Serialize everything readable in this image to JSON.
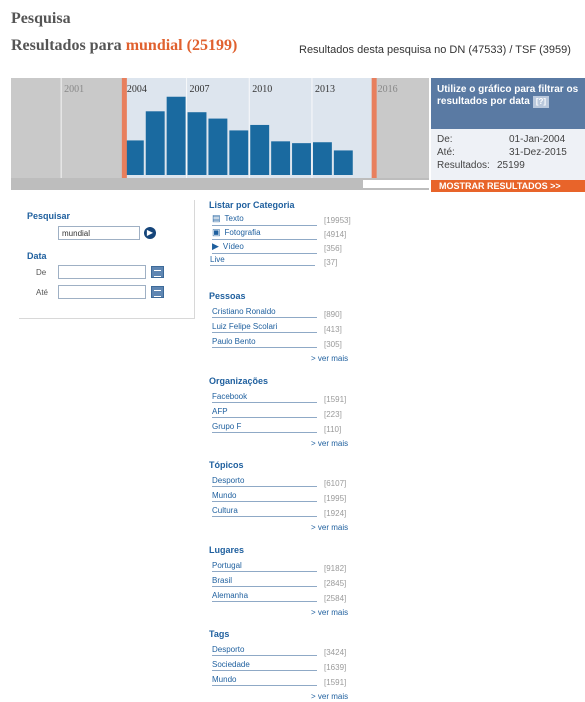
{
  "header": {
    "page_title": "Pesquisa",
    "results_prefix": "Resultados para",
    "query": "mundial",
    "query_count": "(25199)",
    "source_line": "Resultados desta pesquisa no DN (47533) / TSF (3959)"
  },
  "chart_data": {
    "type": "bar",
    "x_tick_labels": [
      "2001",
      "2004",
      "2007",
      "2010",
      "2013",
      "2016"
    ],
    "selected_range": [
      "2004",
      "2015"
    ],
    "categories": [
      "2004",
      "2005",
      "2006",
      "2007",
      "2008",
      "2009",
      "2010",
      "2011",
      "2012",
      "2013",
      "2014",
      "2015"
    ],
    "values": [
      38,
      70,
      86,
      69,
      62,
      49,
      55,
      37,
      35,
      36,
      27,
      0
    ],
    "colors": {
      "bar": "#1a6aa0",
      "bg": "#dde5ee",
      "out_of_range": "#c9c9c9",
      "handle": "#e87f5d"
    }
  },
  "info_panel": {
    "headline": "Utilize o gráfico para filtrar os resultados por data",
    "help_icon": "[?]",
    "from_label": "De:",
    "from_value": "01-Jan-2004",
    "to_label": "Até:",
    "to_value": "31-Dez-2015",
    "results_label": "Resultados:",
    "results_value": "25199",
    "show_results_button": "MOSTRAR RESULTADOS >>"
  },
  "search_panel": {
    "search_label": "Pesquisar",
    "search_value": "mundial",
    "date_label": "Data",
    "from_label": "De",
    "to_label": "Até"
  },
  "categories": {
    "heading": "Listar por Categoria",
    "items": [
      {
        "label": "Texto",
        "count": "[19953]",
        "icon": "text-icon"
      },
      {
        "label": "Fotografia",
        "count": "[4914]",
        "icon": "camera-icon"
      },
      {
        "label": "Vídeo",
        "count": "[356]",
        "icon": "video-icon"
      },
      {
        "label": "Live",
        "count": "[37]",
        "icon": ""
      }
    ]
  },
  "facets": [
    {
      "heading": "Pessoas",
      "items": [
        {
          "label": "Cristiano Ronaldo",
          "count": "[890]"
        },
        {
          "label": "Luiz Felipe Scolari",
          "count": "[413]"
        },
        {
          "label": "Paulo Bento",
          "count": "[305]"
        }
      ],
      "more": "> ver mais"
    },
    {
      "heading": "Organizações",
      "items": [
        {
          "label": "Facebook",
          "count": "[1591]"
        },
        {
          "label": "AFP",
          "count": "[223]"
        },
        {
          "label": "Grupo F",
          "count": "[110]"
        }
      ],
      "more": "> ver mais"
    },
    {
      "heading": "Tópicos",
      "items": [
        {
          "label": "Desporto",
          "count": "[6107]"
        },
        {
          "label": "Mundo",
          "count": "[1995]"
        },
        {
          "label": "Cultura",
          "count": "[1924]"
        }
      ],
      "more": "> ver mais"
    },
    {
      "heading": "Lugares",
      "items": [
        {
          "label": "Portugal",
          "count": "[9182]"
        },
        {
          "label": "Brasil",
          "count": "[2845]"
        },
        {
          "label": "Alemanha",
          "count": "[2584]"
        }
      ],
      "more": "> ver mais"
    },
    {
      "heading": "Tags",
      "items": [
        {
          "label": "Desporto",
          "count": "[3424]"
        },
        {
          "label": "Sociedade",
          "count": "[1639]"
        },
        {
          "label": "Mundo",
          "count": "[1591]"
        }
      ],
      "more": "> ver mais"
    }
  ]
}
